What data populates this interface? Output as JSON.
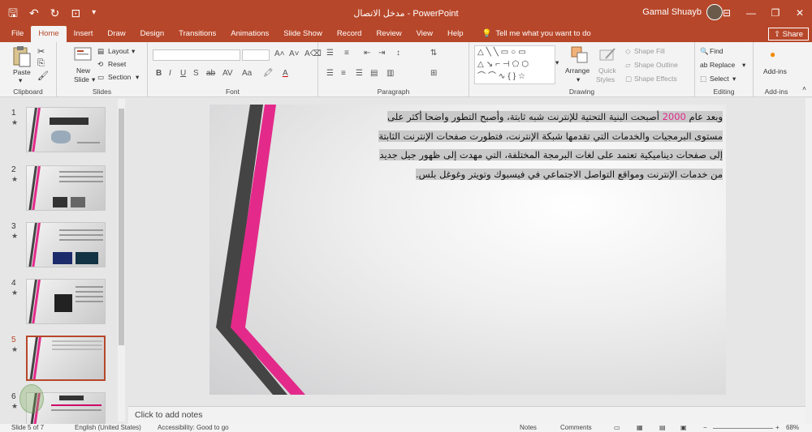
{
  "window": {
    "title": "مدخل الاتصال  -  PowerPoint",
    "user": "Gamal Shuayb"
  },
  "tabs": [
    "File",
    "Home",
    "Insert",
    "Draw",
    "Design",
    "Transitions",
    "Animations",
    "Slide Show",
    "Record",
    "Review",
    "View",
    "Help"
  ],
  "tell_me": "Tell me what you want to do",
  "share": "Share",
  "ribbon": {
    "clipboard": {
      "label": "Clipboard",
      "paste": "Paste"
    },
    "slides": {
      "label": "Slides",
      "new_slide": "New",
      "new_slide2": "Slide",
      "layout": "Layout",
      "reset": "Reset",
      "section": "Section"
    },
    "font": {
      "label": "Font"
    },
    "paragraph": {
      "label": "Paragraph"
    },
    "drawing": {
      "label": "Drawing",
      "arrange": "Arrange",
      "quick_styles": "Quick",
      "quick_styles2": "Styles",
      "shape_fill": "Shape Fill",
      "shape_outline": "Shape Outline",
      "shape_effects": "Shape Effects"
    },
    "editing": {
      "label": "Editing",
      "find": "Find",
      "replace": "Replace",
      "select": "Select"
    },
    "addins": {
      "label": "Add-ins",
      "button": "Add-ins"
    }
  },
  "thumbnails": [
    {
      "num": "1",
      "star": "★",
      "selected": false
    },
    {
      "num": "2",
      "star": "★",
      "selected": false
    },
    {
      "num": "3",
      "star": "★",
      "selected": false
    },
    {
      "num": "4",
      "star": "★",
      "selected": false
    },
    {
      "num": "5",
      "star": "★",
      "selected": true
    },
    {
      "num": "6",
      "star": "★",
      "selected": false
    }
  ],
  "slide": {
    "line1_pre": "وبعد عام ",
    "year": "2000",
    "line1_post": " أصبحت البنية التحتية للإنترنت شبه ثابتة، وأصبح التطور واضحا أكثر على",
    "line2": "مستوى البرمجيات والخدمات التي تقدمها شبكة الإنترنت، فتطورت صفحات الإنترنت الثابتة",
    "line3": "إلى صفحات ديناميكية تعتمد على لغات البرمجة المختلفة، التي مهدت إلى ظهور جيل جديد",
    "line4": "من خدمات الإنترنت ومواقع التواصل الاجتماعي في فيسبوك وتويتر وغوغل بلس."
  },
  "notes_placeholder": "Click to add notes",
  "status": {
    "slide_count": "Slide 5 of 7",
    "language": "English (United States)",
    "accessibility": "Accessibility: Good to go",
    "notes": "Notes",
    "comments": "Comments",
    "zoom": "68%"
  },
  "colors": {
    "accent": "#b7472a",
    "pink": "#e32a8a",
    "dark_stripe": "#444444"
  }
}
